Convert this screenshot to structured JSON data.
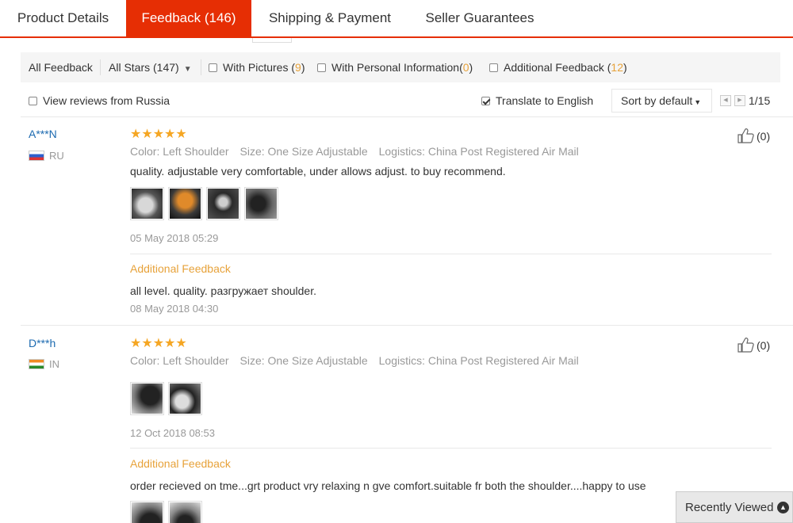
{
  "tabs": [
    {
      "label": "Product Details"
    },
    {
      "label": "Feedback (146)"
    },
    {
      "label": "Shipping & Payment"
    },
    {
      "label": "Seller Guarantees"
    }
  ],
  "filters": {
    "all_feedback": "All Feedback",
    "all_stars": "All Stars (147)",
    "with_pictures": "With Pictures (",
    "with_pictures_count": "9",
    "with_personal": "With Personal Information(",
    "with_personal_count": "0",
    "additional": "Additional Feedback (",
    "additional_count": "12",
    "close_paren": ")"
  },
  "toolbar": {
    "view_russia": "View reviews from Russia",
    "translate": "Translate to English",
    "sort_label": "Sort by default",
    "page": "1/15"
  },
  "reviews": [
    {
      "user": "A***N",
      "country": "RU",
      "stars": "★★★★★",
      "color": "Color: Left Shoulder",
      "size": "Size: One Size Adjustable",
      "logistics": "Logistics: China Post Registered Air Mail",
      "text": "quality. adjustable very comfortable, under allows adjust. to buy recommend.",
      "date": "05 May 2018 05:29",
      "additional_label": "Additional Feedback",
      "additional_text": "all level. quality. разгружает shoulder.",
      "additional_date": "08 May 2018 04:30",
      "helpful": "(0)"
    },
    {
      "user": "D***h",
      "country": "IN",
      "stars": "★★★★★",
      "color": "Color: Left Shoulder",
      "size": "Size: One Size Adjustable",
      "logistics": "Logistics: China Post Registered Air Mail",
      "date": "12 Oct 2018 08:53",
      "additional_label": "Additional Feedback",
      "additional_text": "order recieved on tme...grt product vry relaxing n gve comfort.suitable fr both the shoulder....happy to use",
      "helpful": "(0)"
    }
  ],
  "recently_viewed": "Recently Viewed",
  "colors": {
    "accent": "#e62e04",
    "orange": "#e7a23a",
    "link": "#1c6ab0",
    "star": "#f5a623"
  }
}
